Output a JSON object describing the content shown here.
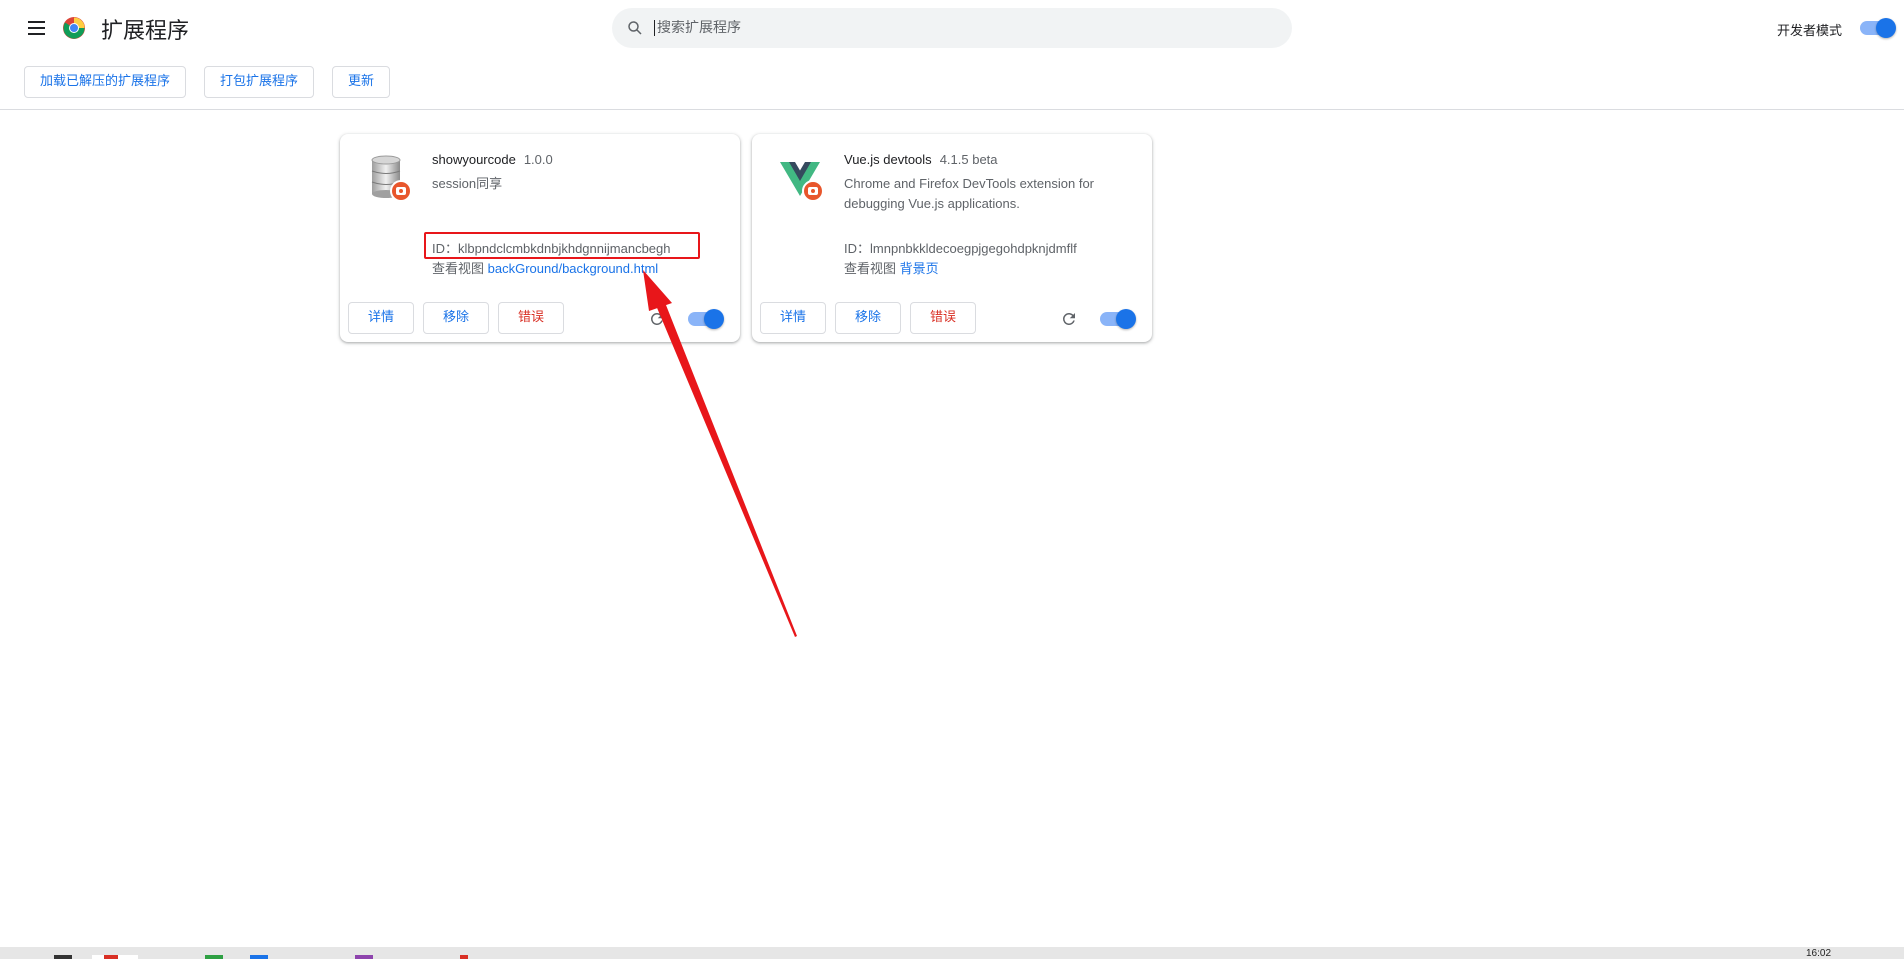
{
  "header": {
    "title": "扩展程序",
    "search_placeholder": "搜索扩展程序",
    "dev_mode_label": "开发者模式",
    "dev_mode_on": true
  },
  "toolbar": {
    "load_unpacked": "加载已解压的扩展程序",
    "pack": "打包扩展程序",
    "update": "更新"
  },
  "extensions": [
    {
      "name": "showyourcode",
      "version": "1.0.0",
      "description": "session同享",
      "id_label": "ID：",
      "id": "klbpndclcmbkdnbjkhdgnnijmancbegh",
      "views_label": "查看视图",
      "views_link": "backGround/background.html",
      "details": "详情",
      "remove": "移除",
      "errors": "错误",
      "enabled": true
    },
    {
      "name": "Vue.js devtools",
      "version": "4.1.5 beta",
      "description": "Chrome and Firefox DevTools extension for debugging Vue.js applications.",
      "id_label": "ID：",
      "id": "lmnpnbkkldecoegpjgegohdpknjdmflf",
      "views_label": "查看视图",
      "views_link": "背景页",
      "details": "详情",
      "remove": "移除",
      "errors": "错误",
      "enabled": true
    }
  ],
  "taskbar": {
    "clock": "16:02"
  },
  "colors": {
    "accent": "#1a73e8",
    "error": "#d93025",
    "annotation": "#e8161a"
  }
}
